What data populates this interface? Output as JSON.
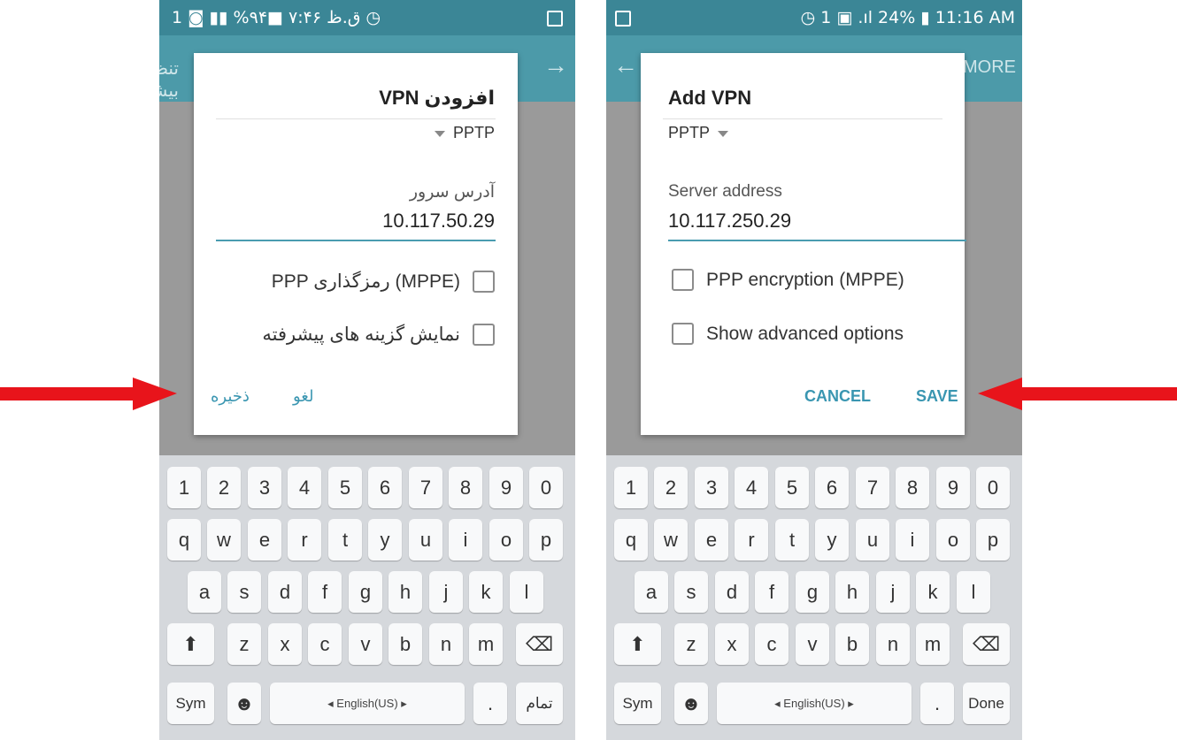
{
  "left_screen": {
    "status_bar": "ق.ظ ۷:۴۶ ■۹۴% ▮▮ ◙ 1 ◷",
    "app_bar_peek": "تنظیمات بیشتر",
    "dialog": {
      "title": "افزودن VPN",
      "vpn_type": "PPTP",
      "server_label": "آدرس سرور",
      "server_value": "10.117.50.29",
      "checkbox_encryption": "PPP رمزگذاری (MPPE)",
      "checkbox_advanced": "نمایش گزینه های پیشرفته",
      "save": "ذخیره",
      "cancel": "لغو"
    },
    "keyboard": {
      "numbers": [
        "1",
        "2",
        "3",
        "4",
        "5",
        "6",
        "7",
        "8",
        "9",
        "0"
      ],
      "row1": [
        "q",
        "w",
        "e",
        "r",
        "t",
        "y",
        "u",
        "i",
        "o",
        "p"
      ],
      "row2": [
        "a",
        "s",
        "d",
        "f",
        "g",
        "h",
        "j",
        "k",
        "l"
      ],
      "row3": [
        "z",
        "x",
        "c",
        "v",
        "b",
        "n",
        "m"
      ],
      "shift": "⬆",
      "backspace": "⌫",
      "sym": "Sym",
      "emoji": "☻",
      "space": "◂ English(US) ▸",
      "period": ".",
      "done": "تمام"
    }
  },
  "right_screen": {
    "status_bar": "◷ 1 ▣ .ıl 24% ▮ 11:16 AM",
    "app_bar_peek": "MORE",
    "dialog": {
      "title": "Add VPN",
      "vpn_type": "PPTP",
      "server_label": "Server address",
      "server_value": "10.117.250.29",
      "checkbox_encryption": "PPP encryption (MPPE)",
      "checkbox_advanced": "Show advanced options",
      "cancel": "CANCEL",
      "save": "SAVE"
    },
    "keyboard": {
      "numbers": [
        "1",
        "2",
        "3",
        "4",
        "5",
        "6",
        "7",
        "8",
        "9",
        "0"
      ],
      "row1": [
        "q",
        "w",
        "e",
        "r",
        "t",
        "y",
        "u",
        "i",
        "o",
        "p"
      ],
      "row2": [
        "a",
        "s",
        "d",
        "f",
        "g",
        "h",
        "j",
        "k",
        "l"
      ],
      "row3": [
        "z",
        "x",
        "c",
        "v",
        "b",
        "n",
        "m"
      ],
      "shift": "⬆",
      "backspace": "⌫",
      "sym": "Sym",
      "emoji": "☻",
      "space": "◂ English(US) ▸",
      "period": ".",
      "done": "Done"
    }
  },
  "colors": {
    "status_bar": "#3b8696",
    "app_bar": "#4c9aa9",
    "accent": "#3a96b1",
    "arrow": "#e8141b"
  }
}
